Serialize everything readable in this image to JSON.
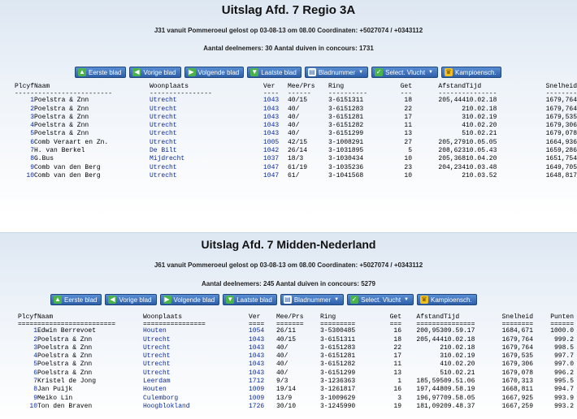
{
  "report1": {
    "title": "Uitslag Afd. 7 Regio 3A",
    "flight_info": "J31 vanuit Pommeroeul gelost op 03-08-13 om 08.00 Coordinaten: +5027074 / +0343112",
    "participants": "Aantal deelnemers: 30 Aantal duiven in concours: 1731",
    "buttons": [
      {
        "label": "Eerste blad",
        "icon": "arrow-up-icon"
      },
      {
        "label": "Vorige blad",
        "icon": "arrow-left-icon"
      },
      {
        "label": "Volgende blad",
        "icon": "arrow-right-icon"
      },
      {
        "label": "Laatste blad",
        "icon": "arrow-down-icon"
      },
      {
        "label": "Bladnummer",
        "icon": "page-icon"
      },
      {
        "label": "Select. Vlucht",
        "icon": "select-icon"
      },
      {
        "label": "Kampioensch.",
        "icon": "crown-icon"
      }
    ],
    "headers": [
      "Plcyf",
      "Naam",
      "Woonplaats",
      "Ver",
      "Mee/Prs",
      "Ring",
      "Get",
      "Afstand",
      "Tijd",
      "Snelheid"
    ],
    "underlines": [
      "-----",
      "--------------------",
      "----------------",
      "----",
      "------",
      "----------",
      "---",
      "-------",
      "--------",
      "--------"
    ],
    "rows": [
      [
        "1",
        "Poelstra & Znn",
        "Utrecht",
        "1043",
        "40/15",
        "3-6151311",
        "18",
        "205,444",
        "10.02.18",
        "1679,764"
      ],
      [
        "2",
        "Poelstra & Znn",
        "Utrecht",
        "1043",
        "40/",
        "3-6151283",
        "22",
        "2",
        "10.02.18",
        "1679,764"
      ],
      [
        "3",
        "Poelstra & Znn",
        "Utrecht",
        "1043",
        "40/",
        "3-6151281",
        "17",
        "3",
        "10.02.19",
        "1679,535"
      ],
      [
        "4",
        "Poelstra & Znn",
        "Utrecht",
        "1043",
        "40/",
        "3-6151282",
        "11",
        "4",
        "10.02.20",
        "1679,306"
      ],
      [
        "5",
        "Poelstra & Znn",
        "Utrecht",
        "1043",
        "40/",
        "3-6151299",
        "13",
        "5",
        "10.02.21",
        "1679,078"
      ],
      [
        "6",
        "Comb Veraart en Zn.",
        "Utrecht",
        "1005",
        "42/15",
        "3-1008291",
        "27",
        "205,279",
        "10.05.05",
        "1664,936"
      ],
      [
        "7",
        "H. van Berkel",
        "De Bilt",
        "1042",
        "26/14",
        "3-1031895",
        "5",
        "208,623",
        "10.05.43",
        "1659,286"
      ],
      [
        "8",
        "G.Bus",
        "Mijdrecht",
        "1037",
        "18/3",
        "3-1030434",
        "10",
        "205,368",
        "10.04.20",
        "1651,754"
      ],
      [
        "9",
        "Comb van den Berg",
        "Utrecht",
        "1047",
        "61/19",
        "3-1035236",
        "23",
        "204,234",
        "10.03.48",
        "1649,705"
      ],
      [
        "10",
        "Comb van den Berg",
        "Utrecht",
        "1047",
        "61/",
        "3-1041568",
        "10",
        "2",
        "10.03.52",
        "1648,817"
      ]
    ]
  },
  "report2": {
    "title": "Uitslag Afd. 7 Midden-Nederland",
    "flight_info": "J61 vanuit Pommeroeul gelost op 03-08-13 om 08.00 Coordinaten: +5027074 / +0343112",
    "participants": "Aantal deelnemers: 245 Aantal duiven in concours: 5279",
    "buttons": [
      {
        "label": "Eerste blad",
        "icon": "arrow-up-icon"
      },
      {
        "label": "Vorige blad",
        "icon": "arrow-left-icon"
      },
      {
        "label": "Volgende blad",
        "icon": "arrow-right-icon"
      },
      {
        "label": "Laatste blad",
        "icon": "arrow-down-icon"
      },
      {
        "label": "Bladnummer",
        "icon": "page-icon"
      },
      {
        "label": "Select. Vlucht",
        "icon": "select-icon"
      },
      {
        "label": "Kampioensch.",
        "icon": "crown-icon"
      }
    ],
    "headers": [
      "Plcyf",
      "Naam",
      "Woonplaats",
      "Ver",
      "Mee/Prs",
      "Ring",
      "Get",
      "Afstand",
      "Tijd",
      "Snelheid",
      "Punten"
    ],
    "underlines": [
      "=====",
      "====================",
      "================",
      "====",
      "=======",
      "=========",
      "===",
      "=======",
      "========",
      "========",
      "======"
    ],
    "rows": [
      [
        "1",
        "Edwin Berrevoet",
        "Houten",
        "1054",
        "26/11",
        "3-5300485",
        "16",
        "200,953",
        "09.59.17",
        "1684,671",
        "1000.0"
      ],
      [
        "2",
        "Poelstra & Znn",
        "Utrecht",
        "1043",
        "40/15",
        "3-6151311",
        "18",
        "205,444",
        "10.02.18",
        "1679,764",
        "999.2"
      ],
      [
        "3",
        "Poelstra & Znn",
        "Utrecht",
        "1043",
        "40/",
        "3-6151283",
        "22",
        "2",
        "10.02.18",
        "1679,764",
        "998.5"
      ],
      [
        "4",
        "Poelstra & Znn",
        "Utrecht",
        "1043",
        "40/",
        "3-6151281",
        "17",
        "3",
        "10.02.19",
        "1679,535",
        "997.7"
      ],
      [
        "5",
        "Poelstra & Znn",
        "Utrecht",
        "1043",
        "40/",
        "3-6151282",
        "11",
        "4",
        "10.02.20",
        "1679,306",
        "997.0"
      ],
      [
        "6",
        "Poelstra & Znn",
        "Utrecht",
        "1043",
        "40/",
        "3-6151299",
        "13",
        "5",
        "10.02.21",
        "1679,078",
        "996.2"
      ],
      [
        "7",
        "Kristel de Jong",
        "Leerdam",
        "1712",
        "9/3",
        "3-1236363",
        "1",
        "185,595",
        "09.51.06",
        "1670,313",
        "995.5"
      ],
      [
        "8",
        "Jan Puijk",
        "Houten",
        "1009",
        "19/14",
        "3-1261817",
        "16",
        "197,448",
        "09.58.19",
        "1668,811",
        "994.7"
      ],
      [
        "9",
        "Meiko Lin",
        "Culemborg",
        "1009",
        "13/9",
        "3-1009629",
        "3",
        "196,977",
        "09.58.05",
        "1667,925",
        "993.9"
      ],
      [
        "10",
        "Ton den Braven",
        "Hoogblokland",
        "1726",
        "30/10",
        "3-1245990",
        "19",
        "181,092",
        "09.48.37",
        "1667,259",
        "993.2"
      ]
    ]
  }
}
